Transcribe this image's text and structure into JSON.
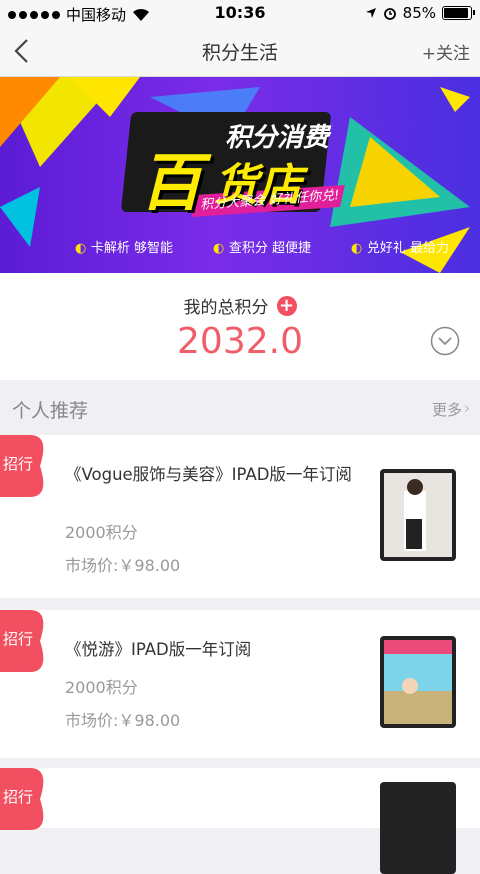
{
  "status": {
    "carrier": "中国移动",
    "time": "10:36",
    "battery": "85%",
    "battery_level": 0.85
  },
  "nav": {
    "title": "积分生活",
    "follow": "+关注"
  },
  "banner": {
    "line1": "积分消费",
    "big1": "百",
    "big2": "货店",
    "slogan": "积分大聚会 好礼任你兑!",
    "features": [
      "卡解析 够智能",
      "查积分 超便捷",
      "兑好礼 最给力"
    ]
  },
  "points": {
    "label": "我的总积分",
    "value": "2032.0"
  },
  "section": {
    "title": "个人推荐",
    "more": "更多"
  },
  "items": [
    {
      "tag": "招行",
      "name": "《Vogue服饰与美容》IPAD版一年订阅",
      "points": "2000积分",
      "price": "市场价:￥98.00",
      "thumb": "vogue-magazine"
    },
    {
      "tag": "招行",
      "name": "《悦游》IPAD版一年订阅",
      "points": "2000积分",
      "price": "市场价:￥98.00",
      "thumb": "yueyou-magazine"
    },
    {
      "tag": "招行",
      "name": "",
      "points": "",
      "price": "",
      "thumb": "magazine"
    }
  ],
  "colors": {
    "accent": "#f25d6a",
    "tag": "#f25060"
  }
}
